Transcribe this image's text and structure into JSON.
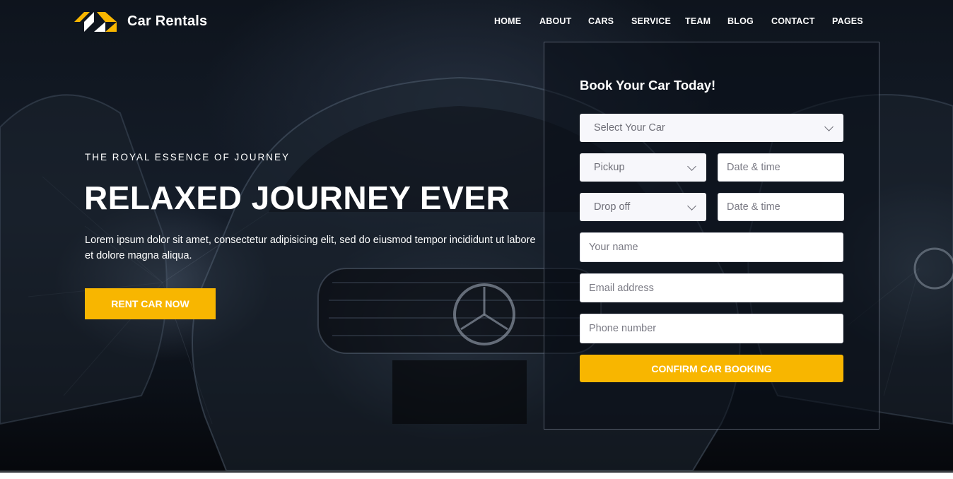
{
  "brand": {
    "name": "Car Rentals",
    "logo_icon": "logo-mark-icon",
    "accent": "#f8b600"
  },
  "nav": {
    "items": [
      {
        "label": "HOME"
      },
      {
        "label": "ABOUT"
      },
      {
        "label": "CARS"
      },
      {
        "label": "SERVICE"
      },
      {
        "label": "TEAM"
      },
      {
        "label": "BLOG"
      },
      {
        "label": "CONTACT"
      },
      {
        "label": "PAGES"
      }
    ]
  },
  "hero": {
    "tagline": "THE ROYAL ESSENCE OF JOURNEY",
    "headline": "RELAXED JOURNEY EVER",
    "description": "Lorem ipsum dolor sit amet, consectetur adipisicing elit, sed do eiusmod tempor incididunt ut labore et dolore magna aliqua.",
    "cta_label": "RENT CAR NOW"
  },
  "booking": {
    "title": "Book Your Car Today!",
    "car_select": {
      "selected": "Select Your Car"
    },
    "pickup_select": {
      "selected": "Pickup"
    },
    "pickup_datetime": {
      "placeholder": "Date & time",
      "value": ""
    },
    "dropoff_select": {
      "selected": "Drop off"
    },
    "dropoff_datetime": {
      "placeholder": "Date & time",
      "value": ""
    },
    "name": {
      "placeholder": "Your name",
      "value": ""
    },
    "email": {
      "placeholder": "Email address",
      "value": ""
    },
    "phone": {
      "placeholder": "Phone number",
      "value": ""
    },
    "submit_label": "CONFIRM CAR BOOKING"
  }
}
